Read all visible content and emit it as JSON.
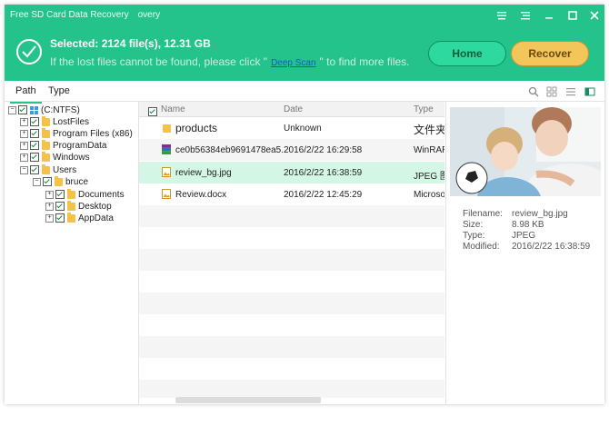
{
  "window": {
    "title": "Free SD Card Data Recovery",
    "title_suffix": "overy",
    "controls": [
      "menu-icon",
      "list-icon",
      "minimize-icon",
      "maximize-icon",
      "close-icon"
    ]
  },
  "header": {
    "selected_text": "Selected: 2124 file(s), 12.31 GB",
    "hint_before": "If the lost files cannot be found, please click \"",
    "hint_link": "Deep Scan",
    "hint_after": "\" to find more files.",
    "home_button": "Home",
    "recover_button": "Recover",
    "accent": "#25c38c"
  },
  "tabs": {
    "path": "Path",
    "type": "Type"
  },
  "tree": {
    "root": "(C:NTFS)",
    "lostfiles": "LostFiles",
    "program_files": "Program Files (x86)",
    "programdata": "ProgramData",
    "windows": "Windows",
    "users": "Users",
    "bruce": "bruce",
    "documents": "Documents",
    "desktop": "Desktop",
    "appdata": "AppData"
  },
  "columns": {
    "name": "Name",
    "date": "Date",
    "type": "Type"
  },
  "files": [
    {
      "name": "products",
      "date": "Unknown",
      "type": "文件夹"
    },
    {
      "name": "ce0b56384eb9691478ea5...",
      "date": "2016/2/22 16:29:58",
      "type": "WinRAR"
    },
    {
      "name": "review_bg.jpg",
      "date": "2016/2/22 16:38:59",
      "type": "JPEG 图"
    },
    {
      "name": "Review.docx",
      "date": "2016/2/22 12:45:29",
      "type": "Microso"
    }
  ],
  "preview": {
    "filename_label": "Filename:",
    "filename": "review_bg.jpg",
    "size_label": "Size:",
    "size": "8.98 KB",
    "type_label": "Type:",
    "type": "JPEG",
    "modified_label": "Modified:",
    "modified": "2016/2/22 16:38:59"
  }
}
